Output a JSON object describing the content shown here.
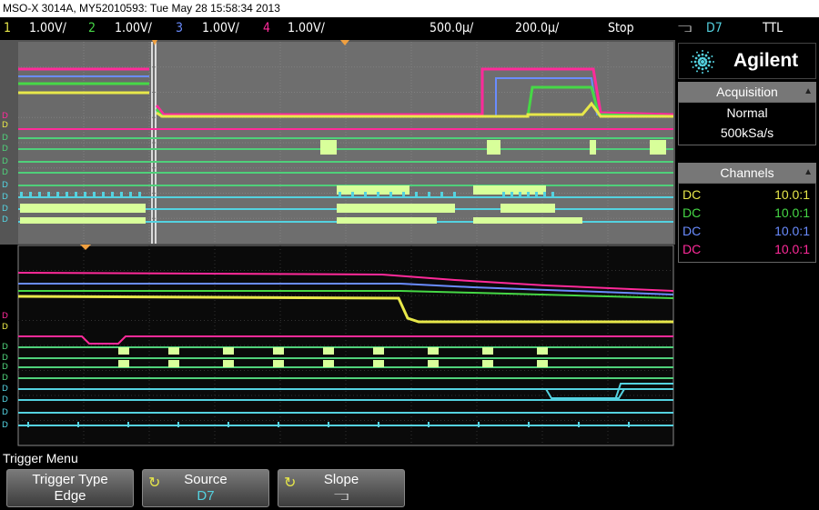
{
  "title_bar": "MSO-X 3014A, MY52010593: Tue May 28 15:58:34 2013",
  "status": {
    "ch1": {
      "num": "1",
      "scale": "1.00V/",
      "color": "#e8e84a"
    },
    "ch2": {
      "num": "2",
      "scale": "1.00V/",
      "color": "#46d846"
    },
    "ch3": {
      "num": "3",
      "scale": "1.00V/",
      "color": "#6a8cff"
    },
    "ch4": {
      "num": "4",
      "scale": "1.00V/",
      "color": "#ff2a9a"
    },
    "time_scale": "500.0µ/",
    "zoom_scale": "200.0µ/",
    "run_state": "Stop",
    "trig_slope": "⫎",
    "trig_src": "D7",
    "trig_level": "TTL"
  },
  "brand": {
    "name": "Agilent"
  },
  "acquisition": {
    "title": "Acquisition",
    "mode": "Normal",
    "rate": "500kSa/s"
  },
  "channels_panel": {
    "title": "Channels",
    "rows": [
      {
        "coupling": "DC",
        "probe": "10.0:1",
        "color": "#e8e84a"
      },
      {
        "coupling": "DC",
        "probe": "10.0:1",
        "color": "#46d846"
      },
      {
        "coupling": "DC",
        "probe": "10.0:1",
        "color": "#6a8cff"
      },
      {
        "coupling": "DC",
        "probe": "10.0:1",
        "color": "#ff2a9a"
      }
    ]
  },
  "softkeys": {
    "menu_title": "Trigger Menu",
    "keys": [
      {
        "label": "Trigger Type",
        "value": "Edge"
      },
      {
        "label": "Source",
        "value": "D7"
      },
      {
        "label": "Slope",
        "value": "⫎"
      }
    ]
  },
  "colors": {
    "ch1": "#e8e84a",
    "ch2": "#46d846",
    "ch3": "#6a8cff",
    "ch4": "#ff2a9a",
    "digital": "#4fd07a",
    "digital_hi": "#d8ff9a",
    "digital_cyan": "#54d2e0"
  }
}
